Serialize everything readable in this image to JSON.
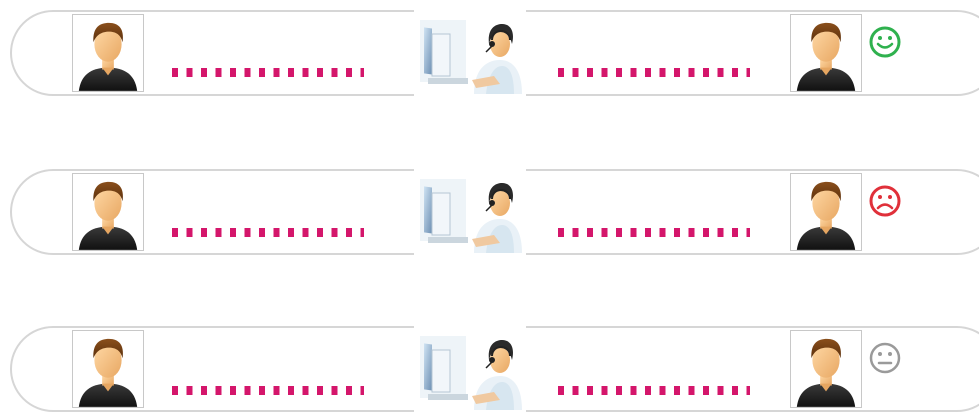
{
  "colors": {
    "dotted_line": "#d4166b",
    "row_border": "#d6d6d6",
    "happy": "#2fb14e",
    "sad": "#e0303a",
    "neutral": "#9a9a9a"
  },
  "rows": [
    {
      "left_person": "person-icon",
      "agent": "call-center-agent-icon",
      "right_person": "person-icon",
      "sentiment": "happy"
    },
    {
      "left_person": "person-icon",
      "agent": "call-center-agent-icon",
      "right_person": "person-icon",
      "sentiment": "sad"
    },
    {
      "left_person": "person-icon",
      "agent": "call-center-agent-icon",
      "right_person": "person-icon",
      "sentiment": "neutral"
    }
  ]
}
